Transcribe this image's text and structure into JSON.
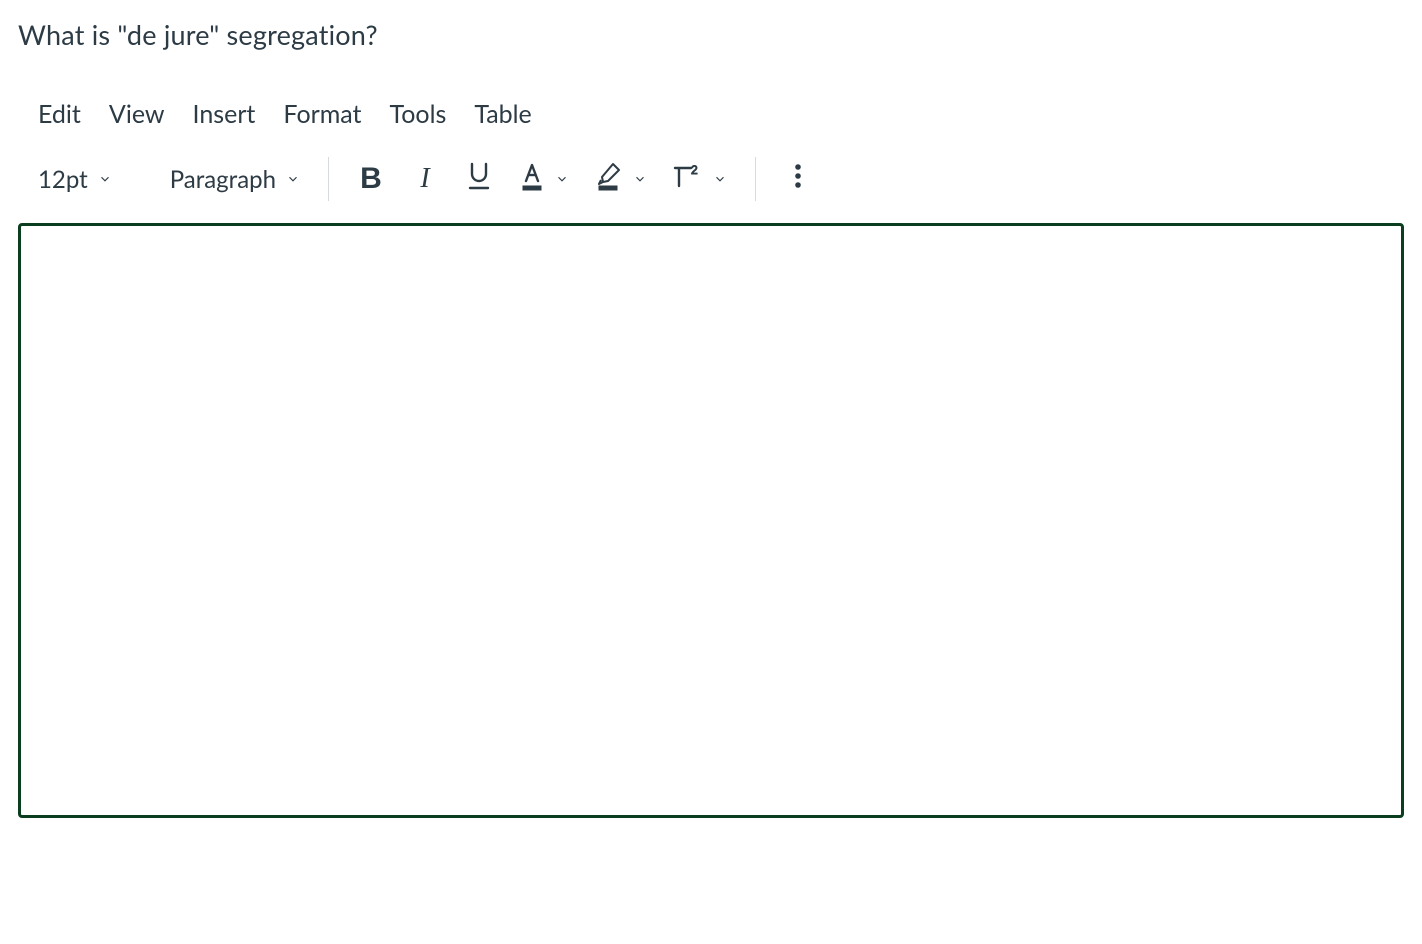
{
  "question": {
    "prompt": "What is \"de jure\" segregation?"
  },
  "menubar": {
    "edit": "Edit",
    "view": "View",
    "insert": "Insert",
    "format": "Format",
    "tools": "Tools",
    "table": "Table"
  },
  "toolbar": {
    "font_size": "12pt",
    "block_format": "Paragraph",
    "icons": {
      "bold": "bold-icon",
      "italic": "italic-icon",
      "underline": "underline-icon",
      "text_color": "text-color-icon",
      "highlight": "highlight-color-icon",
      "superscript": "superscript-icon",
      "more": "more-options-icon"
    }
  },
  "editor": {
    "content": ""
  },
  "colors": {
    "text": "#2d3b45",
    "border_focus": "#0b3d1f",
    "divider": "#d7dade"
  }
}
